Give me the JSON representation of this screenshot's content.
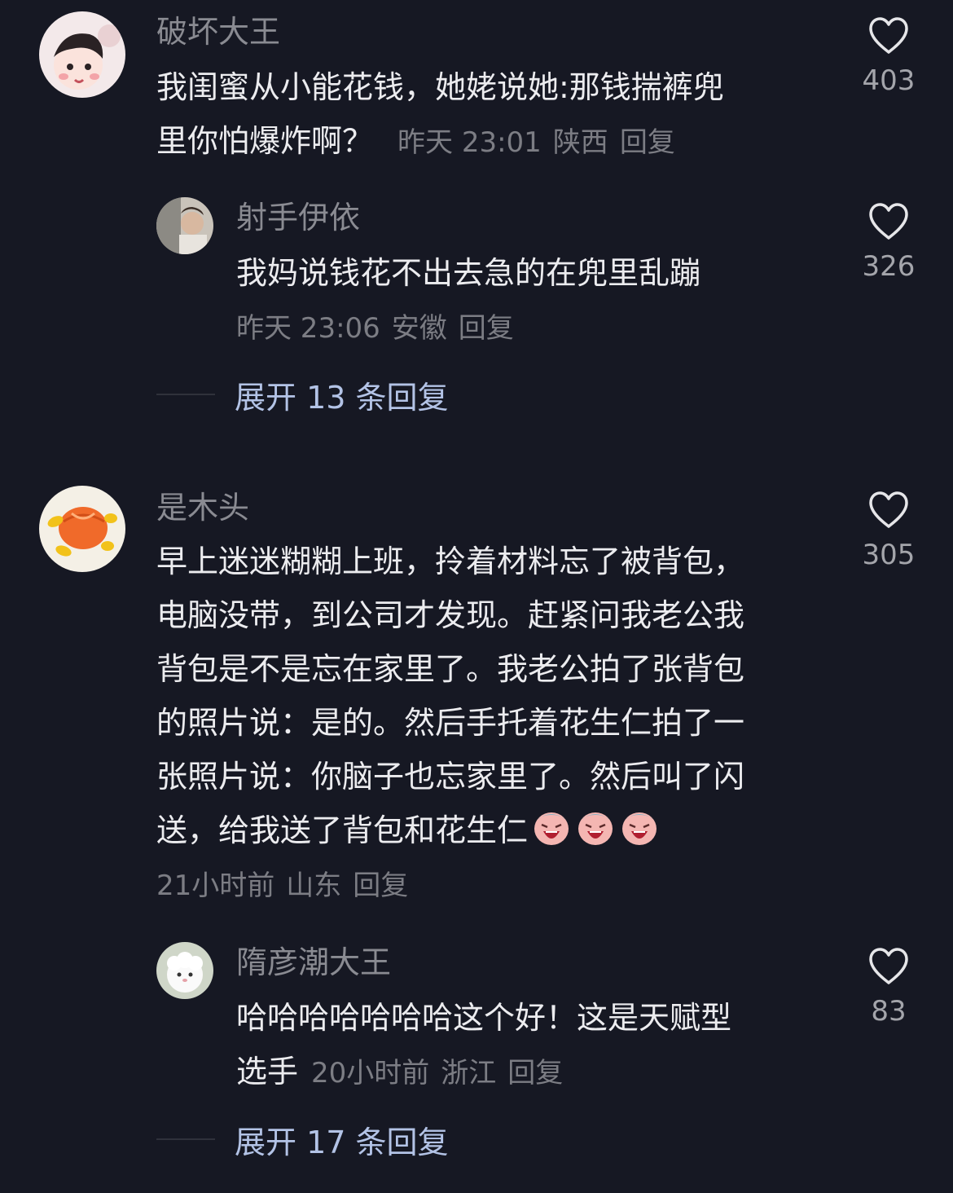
{
  "comments": [
    {
      "username": "破坏大王",
      "text_lines": [
        "我闺蜜从小能花钱，她姥说她:那钱揣裤兜",
        "里你怕爆炸啊？"
      ],
      "time": "昨天 23:01",
      "location": "陕西",
      "reply_label": "回复",
      "likes": "403",
      "replies": [
        {
          "username": "射手伊依",
          "text": "我妈说钱花不出去急的在兜里乱蹦",
          "time": "昨天 23:06",
          "location": "安徽",
          "reply_label": "回复",
          "likes": "326"
        }
      ],
      "expand_label": "展开 13 条回复"
    },
    {
      "username": "是木头",
      "text_lines": [
        "早上迷迷糊糊上班，拎着材料忘了被背包，",
        "电脑没带，到公司才发现。赶紧问我老公我",
        "背包是不是忘在家里了。我老公拍了张背包",
        "的照片说：是的。然后手托着花生仁拍了一",
        "张照片说：你脑子也忘家里了。然后叫了闪",
        "送，给我送了背包和花生仁"
      ],
      "emoji": "crying-laughing-emoji",
      "time": "21小时前",
      "location": "山东",
      "reply_label": "回复",
      "likes": "305",
      "replies": [
        {
          "username": "隋彦潮大王",
          "text_lines": [
            "哈哈哈哈哈哈哈这个好！这是天赋型",
            "选手"
          ],
          "time": "20小时前",
          "location": "浙江",
          "reply_label": "回复",
          "likes": "83"
        }
      ],
      "expand_label": "展开 17 条回复"
    }
  ],
  "colors": {
    "background": "#161823",
    "username": "#8a8b92",
    "text": "#ececef",
    "meta": "#7c7d84",
    "expand": "#b3c3e6"
  }
}
